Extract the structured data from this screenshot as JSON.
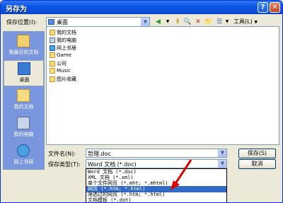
{
  "window": {
    "title": "另存为",
    "help_icon": "?",
    "close_icon": "✕"
  },
  "location": {
    "label": "保存位置(I):",
    "value": "桌面",
    "arrow": "▼"
  },
  "toolbar": {
    "back": "◀",
    "up": "⬆",
    "delete": "✕",
    "new_folder": "📁",
    "views": "☰",
    "tools_label": "工具(L)",
    "tools_arrow": "▼"
  },
  "places": [
    {
      "label": "我最近的文档"
    },
    {
      "label": "桌面"
    },
    {
      "label": "我的文档"
    },
    {
      "label": "我的电脑"
    },
    {
      "label": "网上邻居"
    }
  ],
  "files": [
    {
      "name": "我的文档",
      "icon": "folder"
    },
    {
      "name": "我的电脑",
      "icon": "computer"
    },
    {
      "name": "网上邻居",
      "icon": "network"
    },
    {
      "name": "Game",
      "icon": "folder"
    },
    {
      "name": "公司",
      "icon": "folder"
    },
    {
      "name": "Music",
      "icon": "folder"
    },
    {
      "name": "图片收藏",
      "icon": "folder"
    }
  ],
  "filename": {
    "label": "文件名(N):",
    "value": "哲理.doc"
  },
  "filetype": {
    "label": "保存类型(T):",
    "value": "Word 文档 (*.doc)"
  },
  "buttons": {
    "save": "保存(S)",
    "cancel": "取消"
  },
  "type_options": [
    "Word 文档 (*.doc)",
    "XML 文档 (*.xml)",
    "单个文件网页 (*.mht; *.mhtml)",
    "网页 (*.htm; *.html)",
    "筛选过的网页 (*.htm; *.html)",
    "文档模板 (*.dot)"
  ],
  "highlighted_option_index": 3,
  "colors": {
    "title_bar": "#0a54e3",
    "highlight": "#316ac5",
    "places_bar": "#7a96df",
    "annotation_arrow": "#e00000"
  }
}
